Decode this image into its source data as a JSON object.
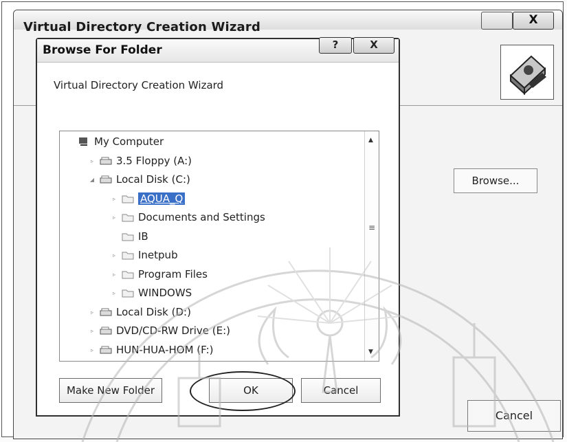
{
  "outer_wizard": {
    "title": "Virtual Directory Creation Wizard",
    "close_glyph": "X",
    "browse_label": "Browse...",
    "cancel_label": "Cancel",
    "icon": "wizard-book-icon"
  },
  "dialog": {
    "title": "Browse For Folder",
    "help_glyph": "?",
    "close_glyph": "X",
    "description": "Virtual Directory Creation Wizard",
    "tree": [
      {
        "label": "My Computer",
        "icon": "computer-icon",
        "indent": 0,
        "expander": ""
      },
      {
        "label": "3.5 Floppy (A:)",
        "icon": "floppy-drive-icon",
        "indent": 1,
        "expander": "▹"
      },
      {
        "label": "Local Disk (C:)",
        "icon": "hard-disk-icon",
        "indent": 1,
        "expander": "◢"
      },
      {
        "label": "AQUA_Q",
        "icon": "folder-icon",
        "indent": 2,
        "expander": "▹",
        "selected": true
      },
      {
        "label": "Documents and Settings",
        "icon": "folder-icon",
        "indent": 2,
        "expander": "▹"
      },
      {
        "label": "IB",
        "icon": "folder-icon",
        "indent": 2,
        "expander": ""
      },
      {
        "label": "Inetpub",
        "icon": "folder-icon",
        "indent": 2,
        "expander": "▹"
      },
      {
        "label": "Program Files",
        "icon": "folder-icon",
        "indent": 2,
        "expander": "▹"
      },
      {
        "label": "WINDOWS",
        "icon": "folder-icon",
        "indent": 2,
        "expander": "▹"
      },
      {
        "label": "Local Disk (D:)",
        "icon": "hard-disk-icon",
        "indent": 1,
        "expander": "▹"
      },
      {
        "label": "DVD/CD-RW Drive (E:)",
        "icon": "dvd-drive-icon",
        "indent": 1,
        "expander": "▹"
      },
      {
        "label": "HUN-HUA-HOM (F:)",
        "icon": "removable-drive-icon",
        "indent": 1,
        "expander": "▹"
      }
    ],
    "buttons": {
      "make_new_folder": "Make New Folder",
      "ok": "OK",
      "cancel": "Cancel"
    }
  },
  "colors": {
    "selection": "#3a6fc7",
    "title_bar": "#e6e6e6"
  }
}
